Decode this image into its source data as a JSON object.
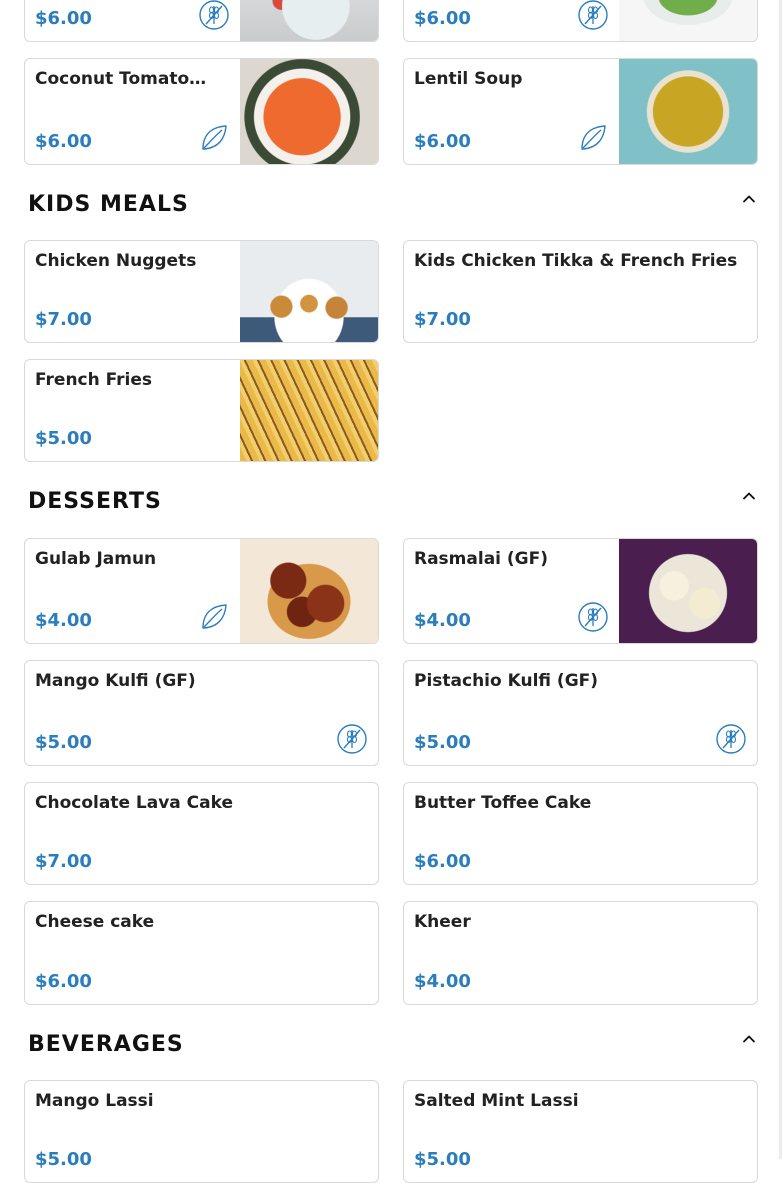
{
  "sections": {
    "soups": {
      "items": [
        {
          "name": "",
          "price": "$6.00",
          "badge": "gluten-free-icon"
        },
        {
          "name": "",
          "price": "$6.00",
          "badge": "gluten-free-icon"
        },
        {
          "name": "Coconut Tomato…",
          "price": "$6.00",
          "badge": "vegan-leaf-icon"
        },
        {
          "name": "Lentil Soup",
          "price": "$6.00",
          "badge": "vegan-leaf-icon"
        }
      ]
    },
    "kids": {
      "title": "KIDS MEALS",
      "items": [
        {
          "name": "Chicken Nuggets",
          "price": "$7.00"
        },
        {
          "name": "Kids Chicken Tikka & French Fries",
          "price": "$7.00"
        },
        {
          "name": "French Fries",
          "price": "$5.00"
        }
      ]
    },
    "desserts": {
      "title": "DESSERTS",
      "items": [
        {
          "name": "Gulab Jamun",
          "price": "$4.00",
          "badge": "vegan-leaf-icon"
        },
        {
          "name": "Rasmalai (GF)",
          "price": "$4.00",
          "badge": "gluten-free-icon"
        },
        {
          "name": "Mango Kulfi (GF)",
          "price": "$5.00",
          "badge": "gluten-free-icon"
        },
        {
          "name": "Pistachio Kulfi (GF)",
          "price": "$5.00",
          "badge": "gluten-free-icon"
        },
        {
          "name": "Chocolate Lava Cake",
          "price": "$7.00"
        },
        {
          "name": "Butter Toffee Cake",
          "price": "$6.00"
        },
        {
          "name": "Cheese cake",
          "price": "$6.00"
        },
        {
          "name": "Kheer",
          "price": "$4.00"
        }
      ]
    },
    "beverages": {
      "title": "BEVERAGES",
      "items": [
        {
          "name": "Mango Lassi",
          "price": "$5.00"
        },
        {
          "name": "Salted Mint Lassi",
          "price": "$5.00"
        }
      ]
    }
  },
  "icons": {
    "collapse": "chevron-up-icon",
    "gluten_free": "gluten-free-icon",
    "vegan": "vegan-leaf-icon"
  },
  "colors": {
    "price": "#2b7dbc",
    "badge": "#2b7dbc",
    "card_border": "#d9d9d9"
  }
}
